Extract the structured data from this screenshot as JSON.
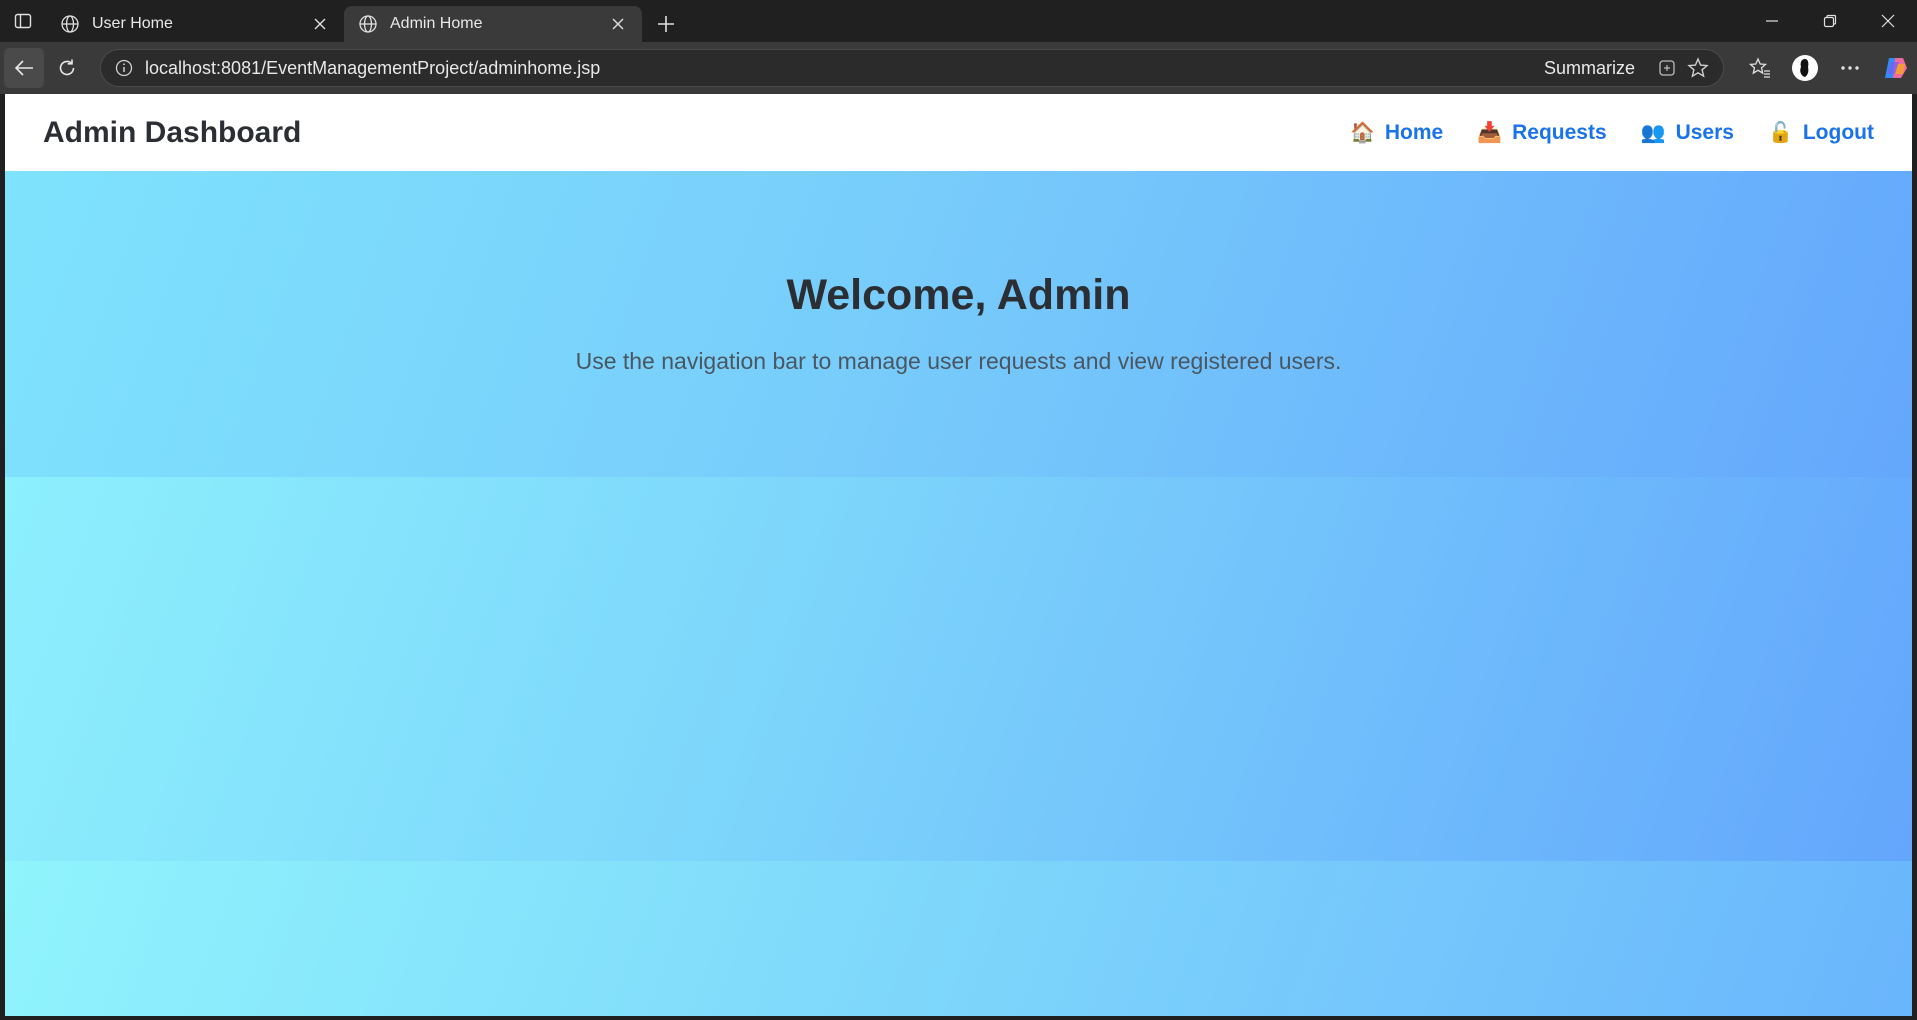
{
  "browser": {
    "tabs": [
      {
        "title": "User Home",
        "active": false
      },
      {
        "title": "Admin Home",
        "active": true
      }
    ],
    "url": "localhost:8081/EventManagementProject/adminhome.jsp",
    "summarize_label": "Summarize"
  },
  "navbar": {
    "brand": "Admin Dashboard",
    "links": [
      {
        "emoji": "🏠",
        "label": "Home"
      },
      {
        "emoji": "📥",
        "label": "Requests"
      },
      {
        "emoji": "👥",
        "label": "Users"
      },
      {
        "emoji": "🔓",
        "label": "Logout"
      }
    ]
  },
  "hero": {
    "title": "Welcome, Admin",
    "subtitle": "Use the navigation bar to manage user requests and view registered users."
  },
  "colors": {
    "link": "#1a73e8",
    "heading": "#2b2f33",
    "gradient_start": "#8cf1fc",
    "gradient_end": "#64a7fc"
  }
}
